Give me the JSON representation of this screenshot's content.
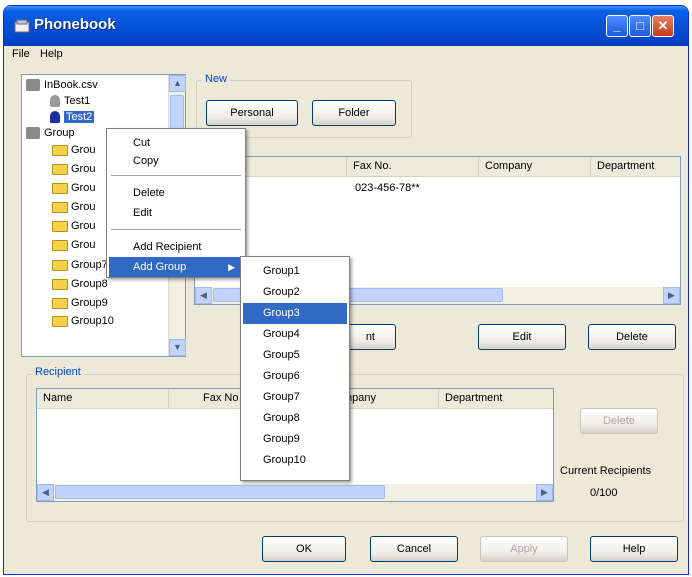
{
  "window": {
    "title": "Phonebook"
  },
  "menu": {
    "file": "File",
    "help": "Help"
  },
  "tree": {
    "root": "InBook.csv",
    "contacts": [
      "Test1",
      "Test2"
    ],
    "group_root": "Group",
    "groups": [
      "Grou",
      "Grou",
      "Grou",
      "Grou",
      "Grou",
      "Grou",
      "Group7",
      "Group8",
      "Group9",
      "Group10"
    ]
  },
  "new_section": {
    "label": "New",
    "personal_button": "Personal",
    "folder_button": "Folder"
  },
  "top_list": {
    "columns": [
      "Fax No.",
      "Company",
      "Department"
    ],
    "rows": [
      {
        "fax": "023-456-78**",
        "company": "",
        "department": ""
      }
    ]
  },
  "middle_buttons": {
    "add_recipient_partial": "nt",
    "edit": "Edit",
    "delete": "Delete"
  },
  "recipient": {
    "label": "Recipient",
    "columns": [
      "Name",
      "Fax No",
      "mpany",
      "Department"
    ],
    "delete_button": "Delete",
    "current_label": "Current Recipients",
    "current_value": "0/100"
  },
  "footer": {
    "ok": "OK",
    "cancel": "Cancel",
    "apply": "Apply",
    "help": "Help"
  },
  "context_menu": {
    "items": [
      "Cut",
      "Copy",
      "Delete",
      "Edit",
      "Add Recipient",
      "Add Group"
    ],
    "highlighted": "Add Group"
  },
  "submenu": {
    "items": [
      "Group1",
      "Group2",
      "Group3",
      "Group4",
      "Group5",
      "Group6",
      "Group7",
      "Group8",
      "Group9",
      "Group10"
    ],
    "highlighted": "Group3"
  },
  "colors": {
    "title_blue": "#0552d8",
    "selection": "#316ac5",
    "group_label": "#0046d5"
  }
}
